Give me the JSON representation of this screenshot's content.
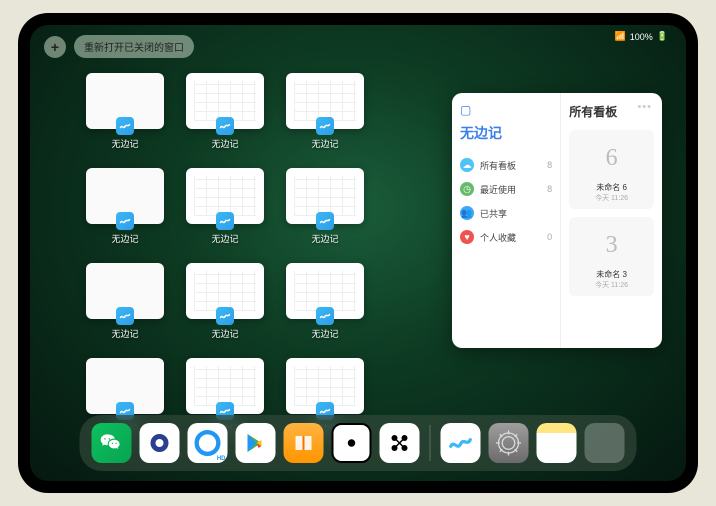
{
  "status": {
    "battery": "100%",
    "signal": "●●●"
  },
  "topBar": {
    "addLabel": "+",
    "reopenLabel": "重新打开已关闭的窗口"
  },
  "appWindows": {
    "label": "无边记",
    "items": [
      {
        "type": "blank"
      },
      {
        "type": "grid"
      },
      {
        "type": "grid"
      },
      {
        "type": "blank"
      },
      {
        "type": "blank"
      },
      {
        "type": "grid"
      },
      {
        "type": "grid"
      },
      {
        "type": "blank"
      },
      {
        "type": "blank"
      },
      {
        "type": "grid"
      },
      {
        "type": "grid"
      },
      {
        "type": "blank"
      },
      {
        "type": "blank"
      },
      {
        "type": "grid"
      },
      {
        "type": "grid"
      }
    ]
  },
  "sidePanel": {
    "leftTitle": "无边记",
    "rightTitle": "所有看板",
    "items": [
      {
        "icon": "c1",
        "glyph": "☁",
        "label": "所有看板",
        "count": "8"
      },
      {
        "icon": "c2",
        "glyph": "◷",
        "label": "最近使用",
        "count": "8"
      },
      {
        "icon": "c3",
        "glyph": "👥",
        "label": "已共享",
        "count": ""
      },
      {
        "icon": "c4",
        "glyph": "♥",
        "label": "个人收藏",
        "count": "0"
      }
    ],
    "boards": [
      {
        "preview": "6",
        "name": "未命名 6",
        "date": "今天 11:26"
      },
      {
        "preview": "3",
        "name": "未命名 3",
        "date": "今天 11:26"
      }
    ]
  },
  "dock": {
    "apps": [
      "wechat",
      "quark",
      "qq",
      "play",
      "books",
      "game",
      "mi",
      "freeform",
      "settings",
      "notes"
    ]
  }
}
